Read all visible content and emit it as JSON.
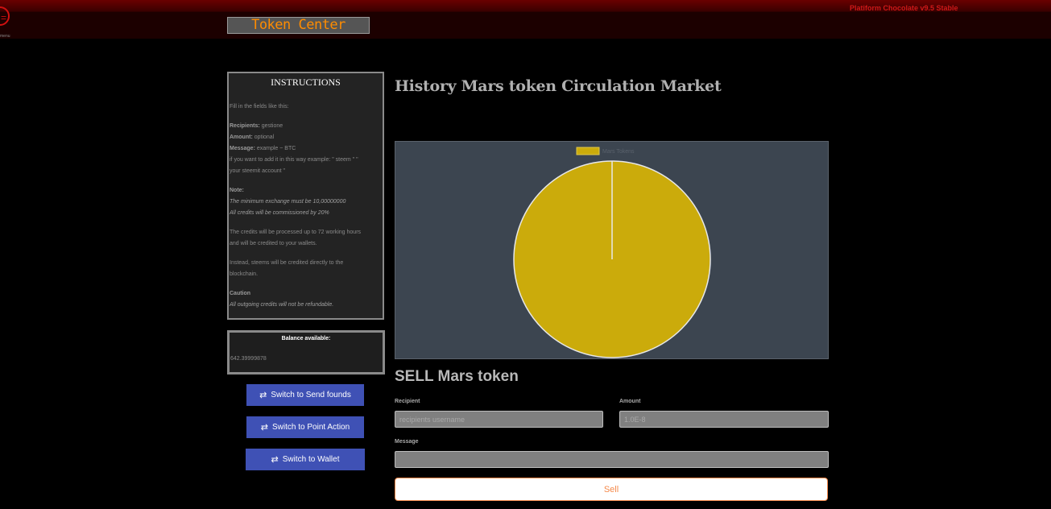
{
  "header": {
    "menu_icon": "menu-icon",
    "menu_glyph": "=",
    "menu_caption": "menu",
    "logo": "Token Center",
    "version": "Platiform Chocolate v9.5 Stable"
  },
  "instructions": {
    "title": "INSTRUCTIONS",
    "intro": "Fill in the fields like this:",
    "recipients_label": "Recipients:",
    "recipients_value": "gestione",
    "amount_label": "Amount:",
    "amount_value": "optional",
    "message_label": "Message:",
    "message_value": "example ~ BTC",
    "add_line_1": "if you want to add it in this way example: \" steem \" \"",
    "add_line_2": "your steemit account \"",
    "note_label": "Note:",
    "note_line_1": "The minimum exchange must be 10,00000000",
    "note_line_2": "All credits will be commissioned by 20%",
    "processed_1": "The credits will be processed up to 72 working hours",
    "processed_2": "and will be credited to your wallets.",
    "steems_1": "Instead, steems will be credited directly to the",
    "steems_2": "blockchain.",
    "caution_label": "Caution",
    "caution_text": "All outgoing credits will not be refundable."
  },
  "balance": {
    "title": "Balance available:",
    "value": "642.39999878"
  },
  "buttons": {
    "switch_icon": "swap-arrows-icon",
    "switch_glyph": "⇄",
    "send_founds": "Switch to Send founds",
    "point_action": "Switch to Point Action",
    "wallet": "Switch to Wallet"
  },
  "main": {
    "heading": "History Mars token Circulation Market"
  },
  "chart_data": {
    "type": "pie",
    "labels": [
      "Mars Tokens"
    ],
    "values": [
      100
    ],
    "colors": [
      "#cbab0b"
    ],
    "legend": "top",
    "legend_entry": "Mars Tokens"
  },
  "sell": {
    "title": "SELL Mars token",
    "recipient_label": "Recipient",
    "recipient_placeholder": "recipients username",
    "amount_label": "Amount",
    "amount_placeholder": "1.0E-8",
    "message_label": "Message",
    "message_value": "",
    "submit_label": "Sell"
  }
}
